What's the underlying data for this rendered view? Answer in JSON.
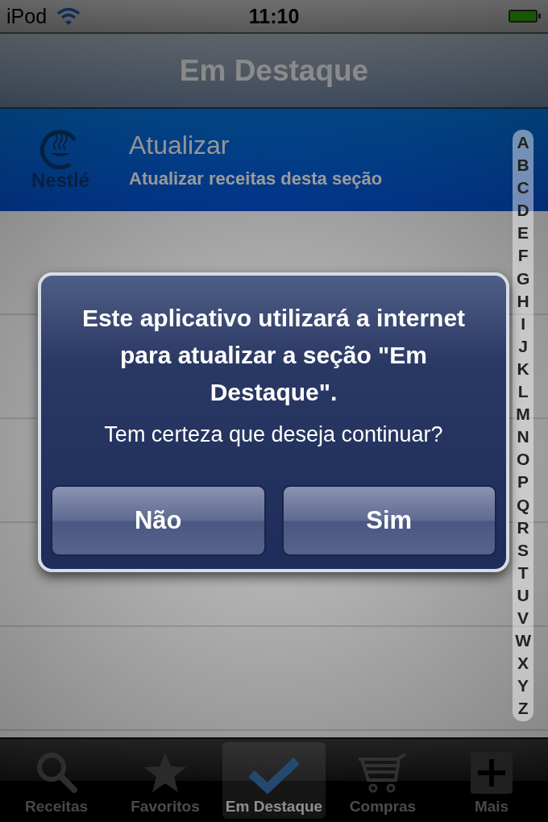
{
  "status_bar": {
    "carrier": "iPod",
    "time": "11:10"
  },
  "nav_bar": {
    "title": "Em Destaque"
  },
  "list": {
    "rows": [
      {
        "logo_text": "Nestlé",
        "title": "Atualizar",
        "subtitle": "Atualizar receitas desta seção",
        "selected": true
      }
    ]
  },
  "index": [
    "A",
    "B",
    "C",
    "D",
    "E",
    "F",
    "G",
    "H",
    "I",
    "J",
    "K",
    "L",
    "M",
    "N",
    "O",
    "P",
    "Q",
    "R",
    "S",
    "T",
    "U",
    "V",
    "W",
    "X",
    "Y",
    "Z"
  ],
  "alert": {
    "title": "Este aplicativo utilizará a internet para atualizar a seção \"Em Destaque\".",
    "message": "Tem certeza que deseja continuar?",
    "buttons": [
      {
        "label": "Não"
      },
      {
        "label": "Sim"
      }
    ]
  },
  "tab_bar": [
    {
      "label": "Receitas",
      "kind": "search",
      "selected": false
    },
    {
      "label": "Favoritos",
      "kind": "star",
      "selected": false
    },
    {
      "label": "Em Destaque",
      "kind": "check",
      "selected": true
    },
    {
      "label": "Compras",
      "kind": "cart",
      "selected": false
    },
    {
      "label": "Mais",
      "kind": "plus",
      "selected": false
    }
  ]
}
